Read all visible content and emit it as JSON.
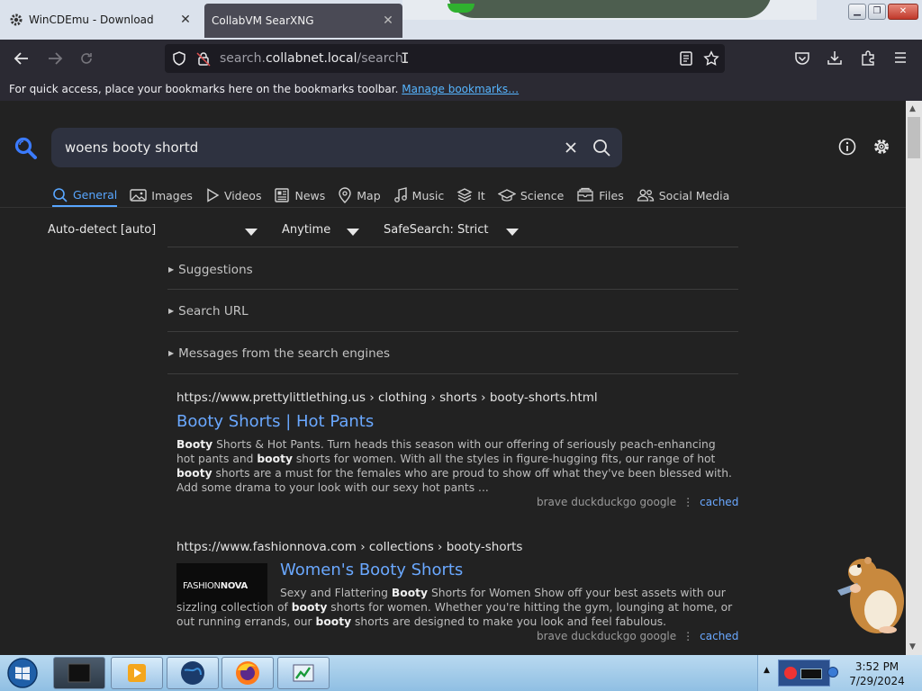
{
  "browser": {
    "tabs": [
      {
        "title": "WinCDEmu - Download",
        "active": false
      },
      {
        "title": "CollabVM SearXNG",
        "active": true
      }
    ],
    "url": {
      "prefix": "search.",
      "host": "collabnet.local",
      "path": "/search"
    },
    "bookmarks_bar": {
      "text": "For quick access, place your bookmarks here on the bookmarks toolbar.",
      "link": "Manage bookmarks…"
    }
  },
  "search": {
    "query": "woens booty shortd",
    "categories": [
      {
        "label": "General",
        "icon": "search-icon",
        "active": true
      },
      {
        "label": "Images",
        "icon": "image-icon"
      },
      {
        "label": "Videos",
        "icon": "play-icon"
      },
      {
        "label": "News",
        "icon": "newspaper-icon"
      },
      {
        "label": "Map",
        "icon": "map-pin-icon"
      },
      {
        "label": "Music",
        "icon": "music-note-icon"
      },
      {
        "label": "It",
        "icon": "layers-icon"
      },
      {
        "label": "Science",
        "icon": "graduation-cap-icon"
      },
      {
        "label": "Files",
        "icon": "files-icon"
      },
      {
        "label": "Social Media",
        "icon": "people-icon"
      }
    ],
    "filters": {
      "language": "Auto-detect [auto]",
      "time": "Anytime",
      "safesearch": "SafeSearch: Strict"
    },
    "expanders": [
      "Suggestions",
      "Search URL",
      "Messages from the search engines"
    ]
  },
  "results": [
    {
      "url": "https://www.prettylittlething.us",
      "path": " › clothing › shorts › booty-shorts.html",
      "title": "Booty Shorts | Hot Pants",
      "snippet_html": "<b>Booty</b> Shorts &amp; Hot Pants. Turn heads this season with our offering of seriously peach-enhancing hot pants and <b>booty</b> shorts for women. With all the styles in figure-hugging fits, our range of hot <b>booty</b> shorts are a must for the females who are proud to show off what they've been blessed with. Add some drama to your look with our sexy hot pants ...",
      "engines": "brave  duckduckgo  google",
      "cached": "cached"
    },
    {
      "url": "https://www.fashionnova.com",
      "path": " › collections › booty-shorts",
      "title": "Women's Booty Shorts",
      "thumbnail_brand": "FASHIONNOVA",
      "snippet_html": "Sexy and Flattering <b>Booty</b> Shorts for Women Show off your best assets with our sizzling collection of <b>booty</b> shorts for women. Whether you're hitting the gym, lounging at home, or out running errands, our <b>booty</b> shorts are designed to make you look and feel fabulous.",
      "engines": "brave  duckduckgo  google",
      "cached": "cached"
    }
  ],
  "taskbar": {
    "time": "3:52 PM",
    "date": "7/29/2024"
  },
  "colors": {
    "accent": "#58a6ff",
    "link": "#6aa8ff",
    "background": "#222222",
    "searchbox": "#2e3240"
  }
}
